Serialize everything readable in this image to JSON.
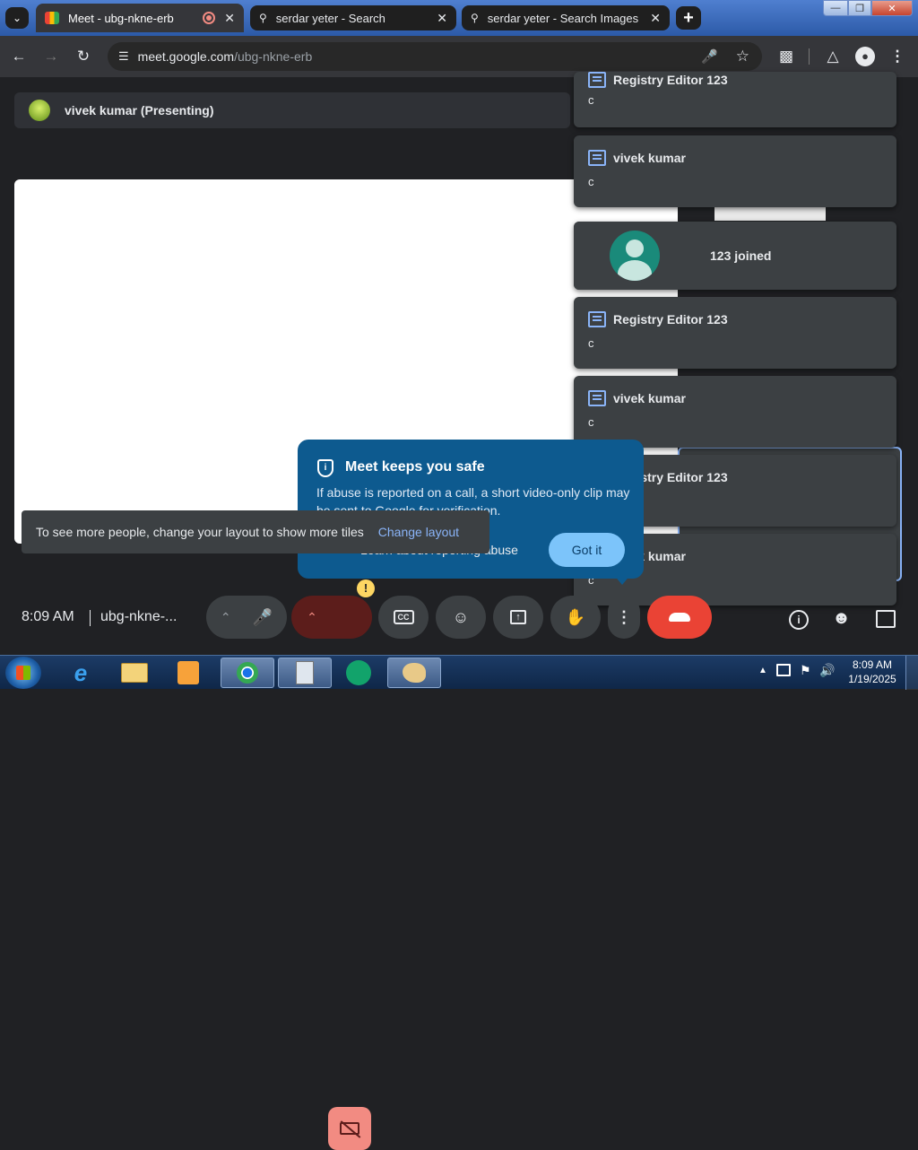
{
  "tabs": [
    {
      "title": "Meet - ubg-nkne-erb"
    },
    {
      "title": "serdar yeter - Search"
    },
    {
      "title": "serdar yeter - Search Images"
    }
  ],
  "url": {
    "host": "meet.google.com",
    "path": "/ubg-nkne-erb"
  },
  "presenter": "vivek kumar (Presenting)",
  "notifications": [
    {
      "sender": "Registry Editor 123",
      "text": "c"
    },
    {
      "sender": "vivek kumar",
      "text": "c"
    },
    {
      "joined": "123 joined"
    },
    {
      "sender": "Registry Editor 123",
      "text": "c"
    },
    {
      "sender": "vivek kumar",
      "text": "c"
    },
    {
      "sender": "Registry Editor 123",
      "text": ""
    },
    {
      "sender": "vivek kumar",
      "text": "c"
    }
  ],
  "safe": {
    "title": "Meet keeps you safe",
    "body": "If abuse is reported on a call, a short video-only clip may be sent to Google for verification.",
    "link": "Learn about reporting abuse",
    "button": "Got it"
  },
  "toast": {
    "text": "To see more people, change your layout to show more tiles",
    "action": "Change layout"
  },
  "meeting": {
    "time": "8:09 AM",
    "code": "ubg-nkne-..."
  },
  "warn_badge": "!",
  "clock": {
    "time": "8:09 AM",
    "date": "1/19/2025"
  },
  "colors": {
    "end_call": "#ea4335",
    "cam_off": "#f28b82",
    "accent": "#8ab4f8"
  }
}
